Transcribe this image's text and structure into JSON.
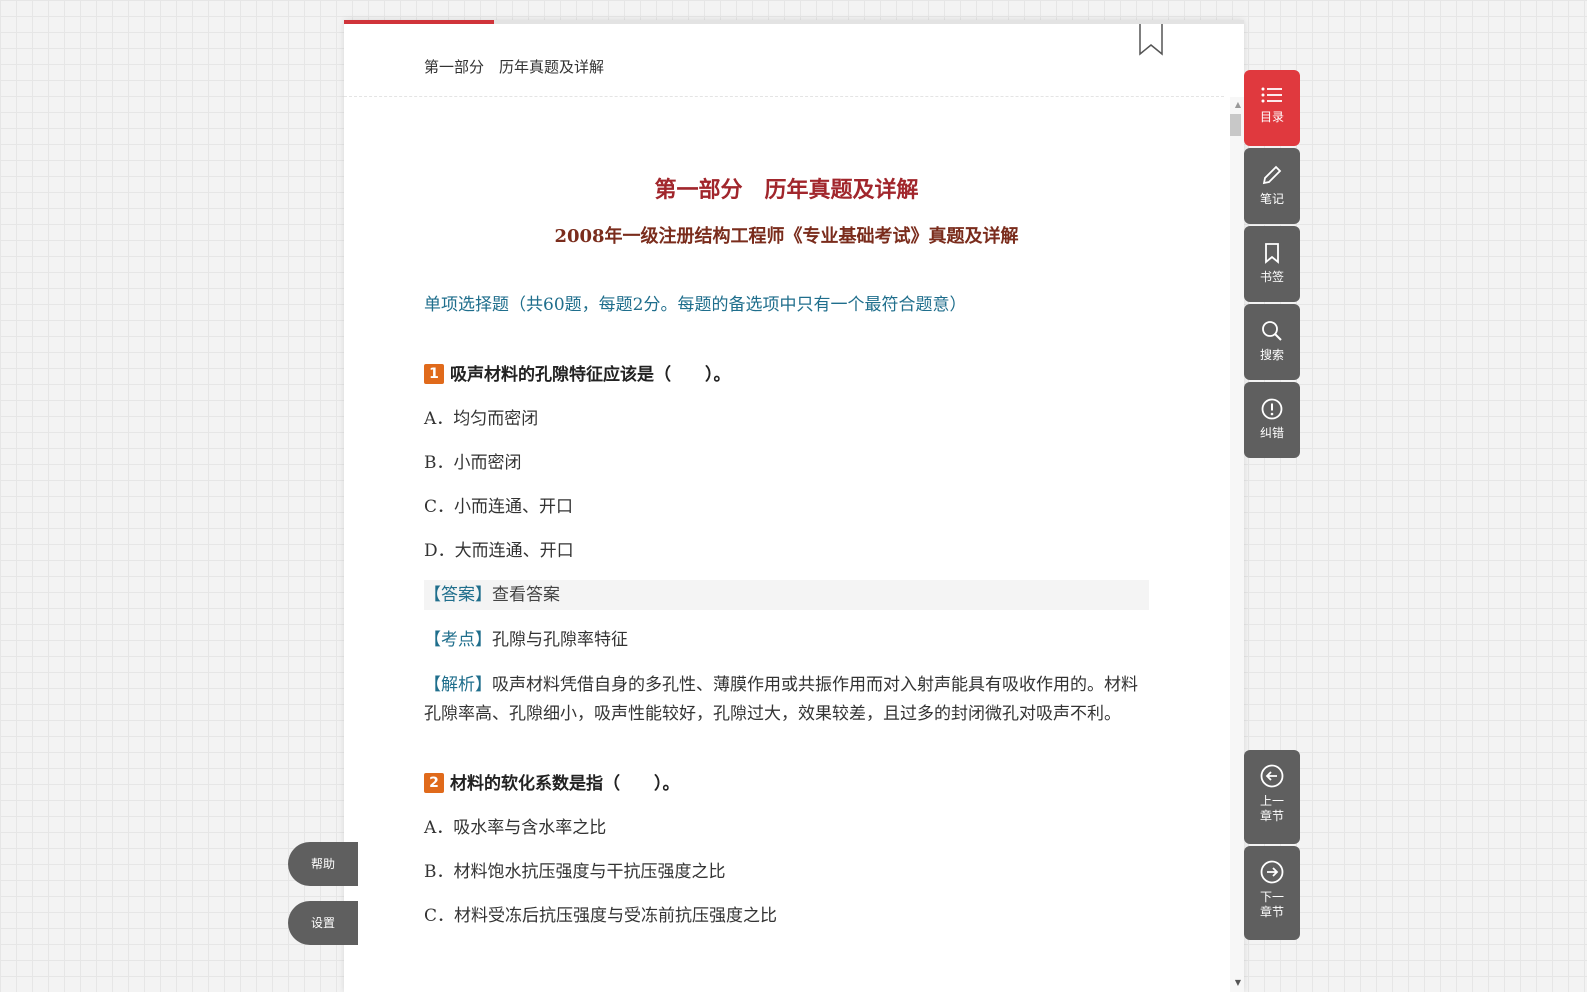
{
  "progress": {
    "fraction": 0.167
  },
  "header": {
    "chapter": "第一部分　历年真题及详解"
  },
  "content": {
    "part_title": "第一部分　历年真题及详解",
    "doc_title": "2008年一级注册结构工程师《专业基础考试》真题及详解",
    "section_intro": "单项选择题（共60题，每题2分。每题的备选项中只有一个最符合题意）",
    "q1": {
      "num": "1",
      "stem": "吸声材料的孔隙特征应该是（　　）。",
      "options": [
        "A．均匀而密闭",
        "B．小而密闭",
        "C．小而连通、开口",
        "D．大而连通、开口"
      ],
      "answer_tag": "【答案】",
      "answer_link": "查看答案",
      "point_tag": "【考点】",
      "point": "孔隙与孔隙率特征",
      "analysis_tag": "【解析】",
      "analysis": "吸声材料凭借自身的多孔性、薄膜作用或共振作用而对入射声能具有吸收作用的。材料孔隙率高、孔隙细小，吸声性能较好，孔隙过大，效果较差，且过多的封闭微孔对吸声不利。"
    },
    "q2": {
      "num": "2",
      "stem": "材料的软化系数是指（　　）。",
      "options": [
        "A．吸水率与含水率之比",
        "B．材料饱水抗压强度与干抗压强度之比",
        "C．材料受冻后抗压强度与受冻前抗压强度之比"
      ]
    }
  },
  "toolbar": {
    "toc": "目录",
    "notes": "笔记",
    "bookmark": "书签",
    "search": "搜索",
    "report": "纠错",
    "prev": "上一章节",
    "next": "下一章节"
  },
  "pills": {
    "help": "帮助",
    "settings": "设置"
  },
  "colors": {
    "accent": "#e0393e",
    "title_red": "#a1262c",
    "link_teal": "#1f6e8c",
    "toolbar_gray": "#5f5f5f",
    "badge_orange": "#e06a1b"
  },
  "icons": {
    "toc": "list-icon",
    "notes": "pencil-icon",
    "bookmark": "bookmark-icon",
    "search": "search-icon",
    "report": "alert-circle-icon",
    "prev": "arrow-left-circle-icon",
    "next": "arrow-right-circle-icon"
  }
}
